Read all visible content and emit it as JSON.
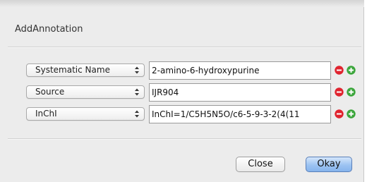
{
  "dialog": {
    "title": "AddAnnotation"
  },
  "rows": [
    {
      "type_label": "Systematic Name",
      "value": "2-amino-6-hydroxypurine"
    },
    {
      "type_label": "Source",
      "value": "IJR904"
    },
    {
      "type_label": "InChI",
      "value": "InChI=1/C5H5N5O/c6-5-9-3-2(4(11"
    }
  ],
  "buttons": {
    "close_label": "Close",
    "okay_label": "Okay"
  },
  "colors": {
    "remove": "#e0242f",
    "add": "#3ca63c",
    "default_button": "#9cc3f2"
  },
  "icons": {
    "popup": "up-down-arrows-icon",
    "remove": "remove-row-icon",
    "add": "add-row-icon"
  }
}
